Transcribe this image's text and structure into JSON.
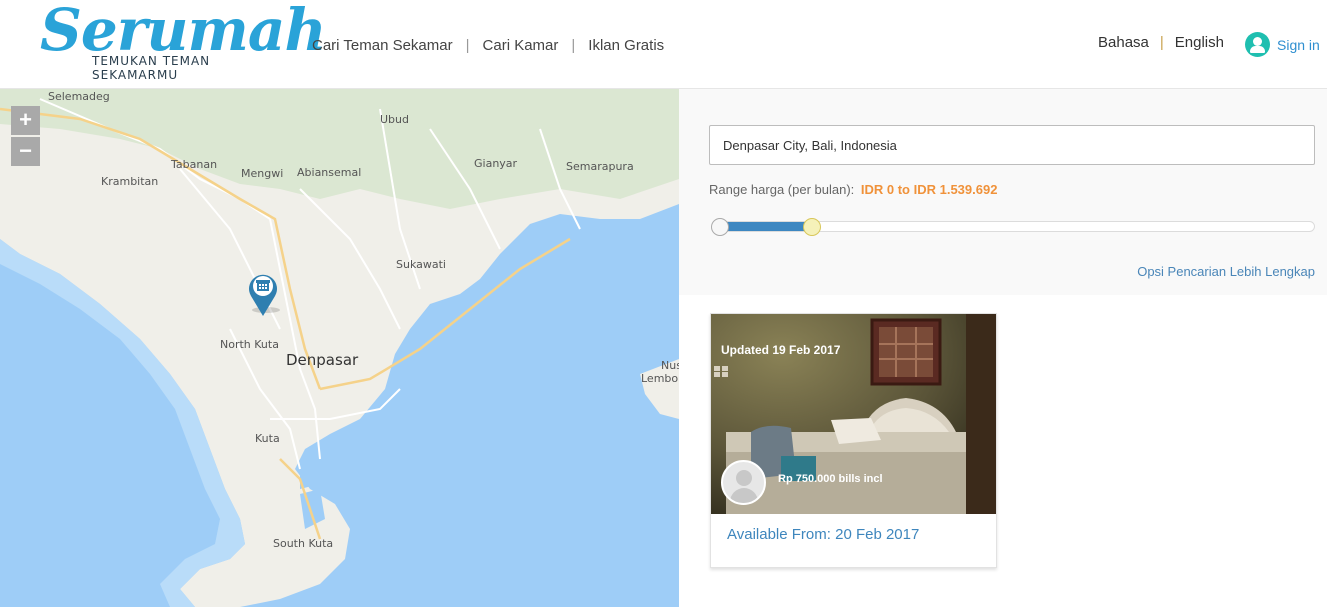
{
  "brand": {
    "logo_word": "Serumah",
    "tagline": "TEMUKAN TEMAN SEKAMARMU",
    "color": "#2aa3d8"
  },
  "nav": {
    "items": [
      {
        "label": "Cari Teman Sekamar"
      },
      {
        "label": "Cari Kamar"
      },
      {
        "label": "Iklan Gratis"
      }
    ],
    "separator": "|"
  },
  "language": {
    "label": "Bahasa",
    "separator": "|",
    "selected": "English"
  },
  "auth": {
    "signin_label": "Sign in",
    "icon": "user-icon",
    "icon_color": "#1fbfb0"
  },
  "map": {
    "zoom_in": "+",
    "zoom_out": "−",
    "marker_icon": "building-marker-icon",
    "labels": [
      {
        "text": "Selemadeg"
      },
      {
        "text": "Ubud"
      },
      {
        "text": "Tabanan"
      },
      {
        "text": "Mengwi"
      },
      {
        "text": "Abiansemal"
      },
      {
        "text": "Gianyar"
      },
      {
        "text": "Semarapura"
      },
      {
        "text": "Krambitan"
      },
      {
        "text": "Sukawati"
      },
      {
        "text": "North Kuta"
      },
      {
        "text": "Denpasar"
      },
      {
        "text": "Kuta"
      },
      {
        "text": "South Kuta"
      },
      {
        "text": "Nus"
      },
      {
        "text": "Lembo"
      }
    ]
  },
  "search": {
    "location_value": "Denpasar City, Bali, Indonesia",
    "range_label": "Range harga (per bulan):",
    "range_value": "IDR 0 to IDR 1.539.692",
    "range_color": "#f0923a",
    "slider_min_fraction": 0,
    "slider_max_fraction": 0.155,
    "more_options": "Opsi Pencarian Lebih Lengkap"
  },
  "listings": [
    {
      "updated": "Updated 19 Feb 2017",
      "price": "Rp 750.000 bills incl",
      "available": "Available From: 20 Feb 2017"
    }
  ]
}
